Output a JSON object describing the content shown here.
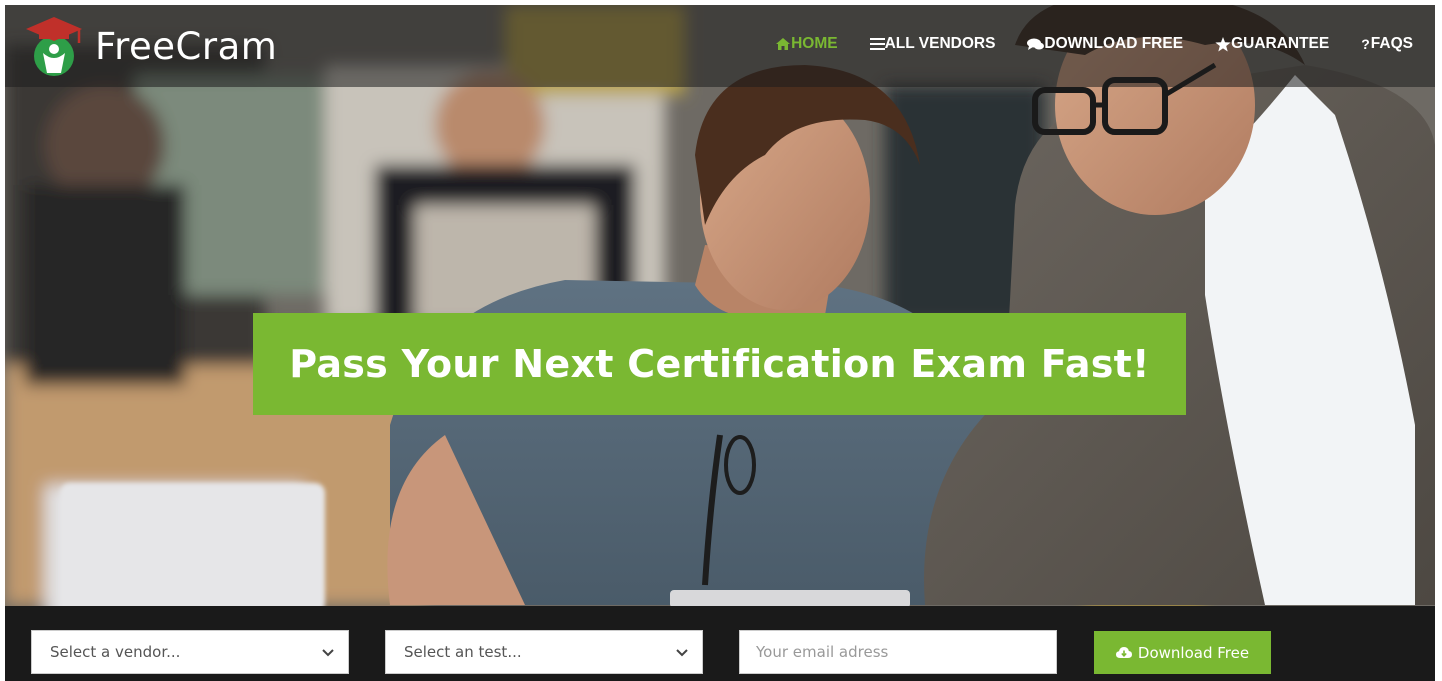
{
  "brand": {
    "name": "FreeCram",
    "logo_icon": "graduation-cap-person-icon",
    "accent_color": "#7ab832"
  },
  "nav": {
    "items": [
      {
        "label": "HOME",
        "icon": "home-icon",
        "active": true
      },
      {
        "label": "ALL VENDORS",
        "icon": "list-icon",
        "active": false
      },
      {
        "label": "DOWNLOAD FREE",
        "icon": "comments-icon",
        "active": false
      },
      {
        "label": "GUARANTEE",
        "icon": "star-icon",
        "active": false
      },
      {
        "label": "FAQS",
        "icon": "question-icon",
        "active": false
      }
    ]
  },
  "hero": {
    "headline": "Pass Your Next Certification Exam Fast!",
    "background": "office-photo-two-men-laptop"
  },
  "search_bar": {
    "vendor_select": {
      "value": "Select a vendor...",
      "icon": "chevron-down-icon"
    },
    "test_select": {
      "value": "Select an test...",
      "icon": "chevron-down-icon"
    },
    "email_input": {
      "placeholder": "Your email adress"
    },
    "download_button": {
      "label": "Download Free",
      "icon": "cloud-download-icon"
    }
  }
}
